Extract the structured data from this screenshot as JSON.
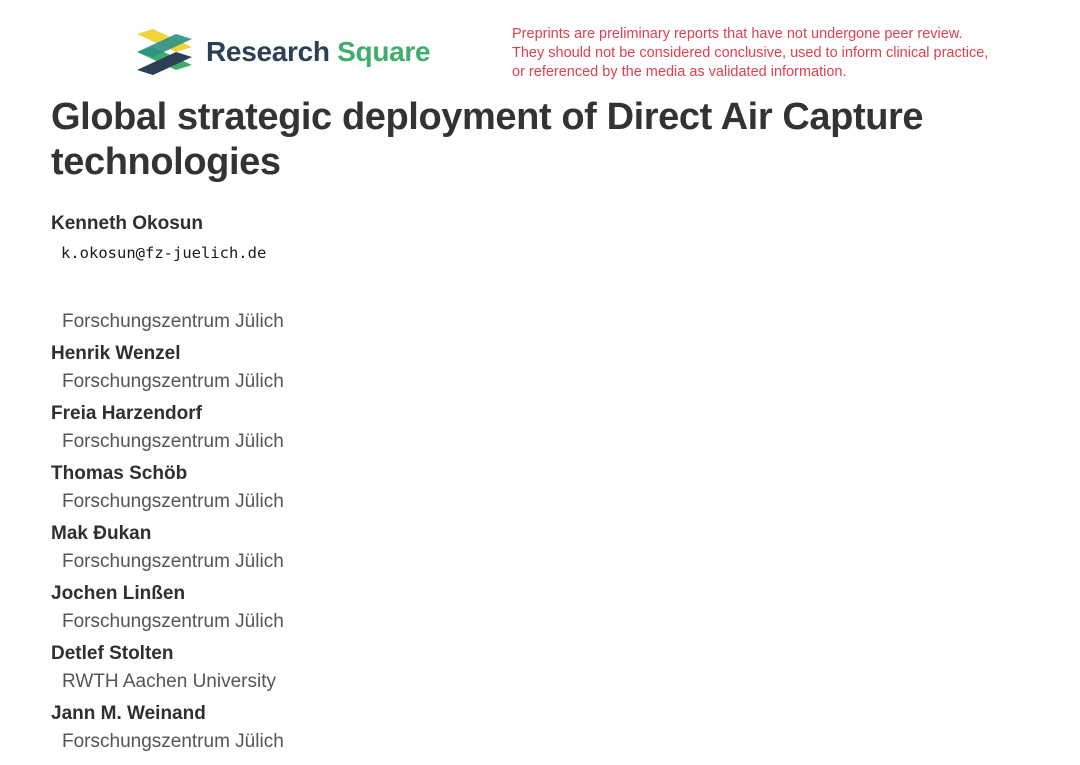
{
  "header": {
    "logo": {
      "word1": "Research",
      "word2": "Square",
      "brand_colors": [
        "#f2d33b",
        "#3fae6a",
        "#2b3f55"
      ],
      "icon": "research-square-logo-icon"
    },
    "disclaimer_lines": [
      "Preprints are preliminary reports that have not undergone peer review.",
      "They should not be considered conclusive, used to inform clinical practice,",
      "or referenced by the media as validated information."
    ],
    "disclaimer_color": "#e04050"
  },
  "paper": {
    "title": "Global strategic deployment of Direct Air Capture technologies"
  },
  "authors": [
    {
      "name": "Kenneth Okosun",
      "email": "k.okosun@fz-juelich.de",
      "affiliation": "Forschungszentrum Jülich"
    },
    {
      "name": "Henrik Wenzel",
      "affiliation": "Forschungszentrum Jülich"
    },
    {
      "name": "Freia Harzendorf",
      "affiliation": "Forschungszentrum Jülich"
    },
    {
      "name": "Thomas Schöb",
      "affiliation": "Forschungszentrum Jülich"
    },
    {
      "name": "Mak Đukan",
      "affiliation": "Forschungszentrum Jülich"
    },
    {
      "name": "Jochen Linßen",
      "affiliation": "Forschungszentrum Jülich"
    },
    {
      "name": "Detlef Stolten",
      "affiliation": "RWTH Aachen University"
    },
    {
      "name": "Jann M. Weinand",
      "affiliation": "Forschungszentrum Jülich"
    }
  ]
}
